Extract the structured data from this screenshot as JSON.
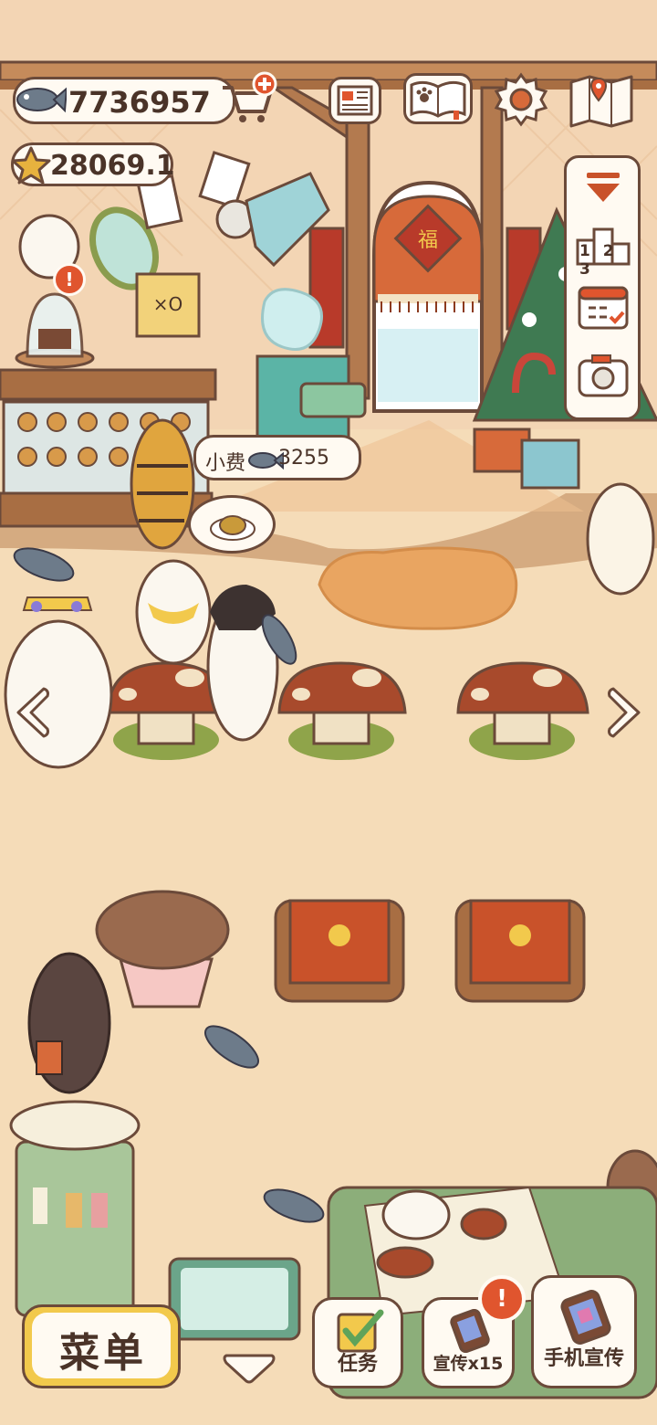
{
  "hud": {
    "fish_count": "7736957",
    "star_count": "28069.1",
    "fish_icon": "fish-icon",
    "star_icon": "star-icon",
    "shop_icon": "shopping-cart-plus-icon"
  },
  "top_buttons": [
    {
      "name": "newspaper-button",
      "icon": "newspaper-icon"
    },
    {
      "name": "cat-book-button",
      "icon": "paw-book-icon"
    },
    {
      "name": "settings-button",
      "icon": "gear-icon"
    },
    {
      "name": "map-button",
      "icon": "map-pin-icon"
    }
  ],
  "side_panel": {
    "items": [
      {
        "name": "collapse-button",
        "icon": "chevron-down-icon"
      },
      {
        "name": "ranking-button",
        "icon": "podium-icon",
        "label": "1 2 3"
      },
      {
        "name": "calendar-button",
        "icon": "calendar-check-icon"
      },
      {
        "name": "camera-button",
        "icon": "camera-icon"
      }
    ]
  },
  "tip_bubble": {
    "label": "小费",
    "amount": "3255"
  },
  "nav": {
    "left_arrow": "chevron-left-icon",
    "right_arrow": "chevron-right-icon",
    "down_arrow": "chevron-down-icon"
  },
  "bottom_bar": {
    "menu_label": "菜单",
    "tasks_label": "任务",
    "promote_label": "宣传x15",
    "phone_promote_label": "手机宣传",
    "alert_mark": "!"
  },
  "colors": {
    "floor": "#f5dcb8",
    "wall": "#f3d9bb",
    "outline": "#6b4a3a",
    "mushroom_red": "#a84a2c",
    "grass": "#8fa44a",
    "alert_red": "#e0552e",
    "menu_yellow": "#f2c94c"
  }
}
